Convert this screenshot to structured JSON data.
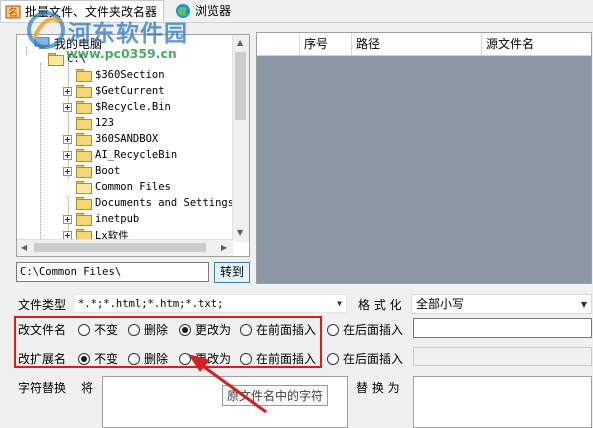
{
  "tabs": [
    {
      "label": "批量文件、文件夹改名器",
      "icon": "rename-app-icon"
    },
    {
      "label": "浏览器",
      "icon": "browser-icon"
    }
  ],
  "watermark": {
    "name": "河东软件园",
    "url": "www.pc0359.cn"
  },
  "tree": {
    "root_label": "我的电脑",
    "drive_label": "C:\\",
    "items": [
      {
        "label": "$360Section",
        "expandable": false
      },
      {
        "label": "$GetCurrent",
        "expandable": true
      },
      {
        "label": "$Recycle.Bin",
        "expandable": true
      },
      {
        "label": "123",
        "expandable": false
      },
      {
        "label": "360SANDBOX",
        "expandable": true
      },
      {
        "label": "AI_RecycleBin",
        "expandable": true
      },
      {
        "label": "Boot",
        "expandable": true
      },
      {
        "label": "Common Files",
        "expandable": false
      },
      {
        "label": "Documents and Settings",
        "expandable": false
      },
      {
        "label": "inetpub",
        "expandable": true
      },
      {
        "label": "Lx软件",
        "expandable": true
      }
    ]
  },
  "grid": {
    "columns": [
      "",
      "序号",
      "路径",
      "源文件名"
    ]
  },
  "path": {
    "value": "C:\\Common Files\\",
    "goto_label": "转到"
  },
  "filetype": {
    "label": "文件类型",
    "value": "*.*;*.html;*.htm;*.txt;"
  },
  "format": {
    "label": "格 式 化",
    "value": "全部小写"
  },
  "rename": {
    "label": "改文件名",
    "options": [
      "不变",
      "删除",
      "更改为",
      "在前面插入",
      "在后面插入"
    ],
    "selected": "更改为"
  },
  "ext": {
    "label": "改扩展名",
    "options": [
      "不变",
      "删除",
      "更改为",
      "在前面插入",
      "在后面插入"
    ],
    "selected": "不变"
  },
  "replace": {
    "label": "字符替换",
    "from_label": "将",
    "to_label": "替 换 为",
    "tooltip": "原文件名中的字符"
  },
  "colors": {
    "highlight_box": "#e01b1b",
    "arrow": "#d42020",
    "grid_bg": "#8d96a4"
  }
}
